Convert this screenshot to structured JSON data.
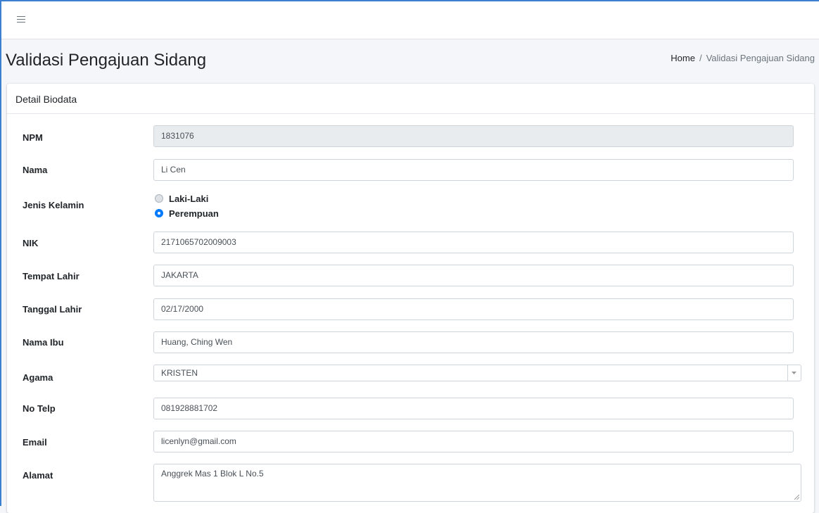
{
  "navbar": {
    "menu_icon": "hamburger-icon"
  },
  "header": {
    "title": "Validasi Pengajuan Sidang",
    "breadcrumb": {
      "home": "Home",
      "separator": "/",
      "current": "Validasi Pengajuan Sidang"
    }
  },
  "card": {
    "title": "Detail Biodata",
    "fields": {
      "npm": {
        "label": "NPM",
        "value": "1831076"
      },
      "nama": {
        "label": "Nama",
        "value": "Li Cen"
      },
      "jenis_kelamin": {
        "label": "Jenis Kelamin",
        "options": [
          "Laki-Laki",
          "Perempuan"
        ],
        "selected": "Perempuan"
      },
      "nik": {
        "label": "NIK",
        "value": "2171065702009003"
      },
      "tempat_lahir": {
        "label": "Tempat Lahir",
        "value": "JAKARTA"
      },
      "tanggal_lahir": {
        "label": "Tanggal Lahir",
        "value": "02/17/2000"
      },
      "nama_ibu": {
        "label": "Nama Ibu",
        "value": "Huang, Ching Wen"
      },
      "agama": {
        "label": "Agama",
        "value": "KRISTEN"
      },
      "no_telp": {
        "label": "No Telp",
        "value": "081928881702"
      },
      "email": {
        "label": "Email",
        "value": "licenlyn@gmail.com"
      },
      "alamat": {
        "label": "Alamat",
        "value": "Anggrek Mas 1 Blok L No.5"
      }
    }
  },
  "colors": {
    "accent": "#007bff",
    "frame": "#3c7fd1",
    "background": "#f4f6f9"
  }
}
